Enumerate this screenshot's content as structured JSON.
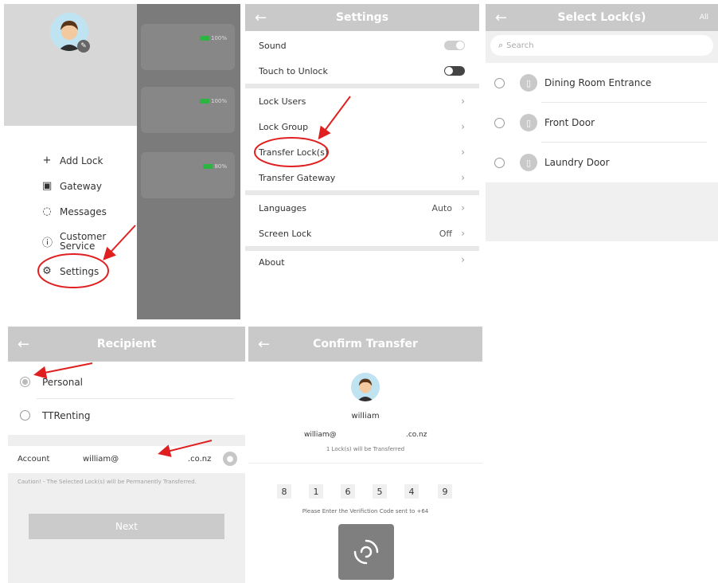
{
  "drawer": {
    "battery_levels": [
      "100%",
      "100%",
      "80%"
    ],
    "menu": [
      {
        "label": "Add Lock",
        "icon": "plus-icon"
      },
      {
        "label": "Gateway",
        "icon": "gateway-icon"
      },
      {
        "label": "Messages",
        "icon": "message-icon"
      },
      {
        "label": "Customer Service",
        "icon": "info-icon"
      },
      {
        "label": "Settings",
        "icon": "gear-icon"
      }
    ]
  },
  "settings": {
    "title": "Settings",
    "rows": {
      "sound": "Sound",
      "touch_unlock": "Touch to Unlock",
      "lock_users": "Lock Users",
      "lock_group": "Lock Group",
      "transfer_locks": "Transfer Lock(s)",
      "transfer_gateway": "Transfer Gateway",
      "languages": "Languages",
      "languages_value": "Auto",
      "screen_lock": "Screen Lock",
      "screen_lock_value": "Off",
      "about": "About"
    },
    "sound_on": true,
    "touch_unlock_on": false
  },
  "select_locks": {
    "title": "Select Lock(s)",
    "all_label": "All",
    "search_placeholder": "Search",
    "locks": [
      "Dining Room Entrance",
      "Front Door",
      "Laundry Door"
    ]
  },
  "recipient": {
    "title": "Recipient",
    "options": [
      "Personal",
      "TTRenting"
    ],
    "selected": "Personal",
    "account_label": "Account",
    "account_prefix": "william@",
    "account_suffix": ".co.nz",
    "caution": "Caution! - The Selected Lock(s) will be Permanently Transferred.",
    "next_label": "Next"
  },
  "confirm": {
    "title": "Confirm Transfer",
    "username": "william",
    "email_prefix": "william@",
    "email_suffix": ".co.nz",
    "transfer_note": "1 Lock(s) will be Transferred",
    "code_digits": [
      "8",
      "1",
      "6",
      "5",
      "4",
      "9"
    ],
    "code_prompt": "Please Enter the Verifiction Code sent to +64"
  },
  "colors": {
    "header_gray": "#c9c9c9",
    "annotation_red": "#e02020",
    "battery_green": "#2db544"
  }
}
